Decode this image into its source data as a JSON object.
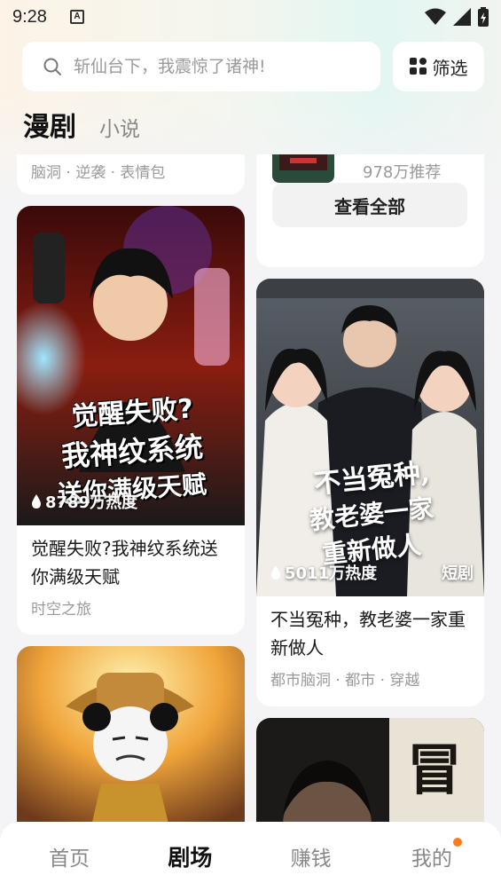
{
  "status_bar": {
    "time": "9:28",
    "notif_icon": "a-icon"
  },
  "search": {
    "placeholder": "斩仙台下，我震惊了诸神!"
  },
  "filter": {
    "label": "筛选"
  },
  "tabs": [
    {
      "label": "漫剧",
      "active": true
    },
    {
      "label": "小说",
      "active": false
    }
  ],
  "feed": {
    "left": [
      {
        "tags": "脑洞 · 逆袭 · 表情包"
      },
      {
        "cover_text": [
          "觉醒失败?",
          "我神纹系统",
          "送你满级天赋"
        ],
        "heat": "8789万热度",
        "title": "觉醒失败?我神纹系统送你满级天赋",
        "tags": "时空之旅"
      },
      {
        "title": ""
      }
    ],
    "right": [
      {
        "recommend": "978万推荐",
        "view_all": "查看全部"
      },
      {
        "cover_text": [
          "不当冤种,",
          "教老婆一家",
          "重新做人"
        ],
        "heat": "5011万热度",
        "badge": "短剧",
        "title": "不当冤种，教老婆一家重新做人",
        "tags": "都市脑洞 · 都市 · 穿越"
      },
      {
        "cover_text": [
          "冒"
        ]
      }
    ]
  },
  "nav": [
    {
      "label": "首页",
      "active": false
    },
    {
      "label": "剧场",
      "active": true
    },
    {
      "label": "赚钱",
      "active": false
    },
    {
      "label": "我的",
      "active": false,
      "dot": true
    }
  ],
  "colors": {
    "accent_dot": "#ff7a1a",
    "card_bg": "#ffffff",
    "page_bg": "#f4f4f6"
  }
}
